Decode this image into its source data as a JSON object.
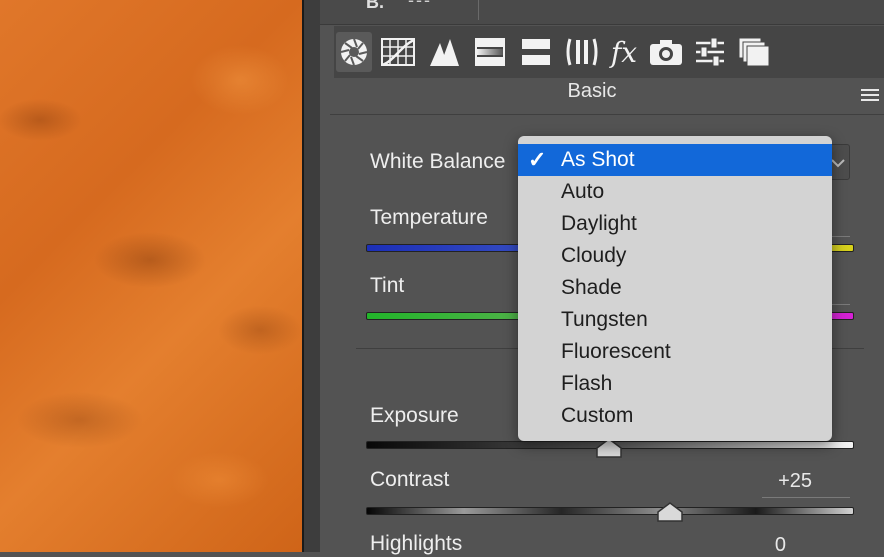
{
  "top_strip": {
    "label": "B.",
    "dashes": "---"
  },
  "toolbar": {
    "tools": [
      {
        "name": "basic-aperture-icon",
        "active": true
      },
      {
        "name": "tone-curve-grid-icon",
        "active": false
      },
      {
        "name": "detail-triangles-icon",
        "active": false
      },
      {
        "name": "hsl-gradient-icon",
        "active": false
      },
      {
        "name": "split-toning-icon",
        "active": false
      },
      {
        "name": "lens-corrections-icon",
        "active": false
      },
      {
        "name": "fx-effects-icon",
        "active": false
      },
      {
        "name": "camera-calibration-icon",
        "active": false
      },
      {
        "name": "presets-sliders-icon",
        "active": false
      },
      {
        "name": "snapshots-stack-icon",
        "active": false
      }
    ],
    "fx_text": "fx"
  },
  "section": {
    "title": "Basic"
  },
  "white_balance": {
    "label": "White Balance"
  },
  "sliders": {
    "temperature": {
      "label": "Temperature"
    },
    "tint": {
      "label": "Tint"
    },
    "exposure": {
      "label": "Exposure",
      "position": 0.5
    },
    "contrast": {
      "label": "Contrast",
      "value": "+25",
      "position": 0.625
    },
    "highlights": {
      "label": "Highlights",
      "value": "0"
    }
  },
  "dropdown": {
    "check_mark": "✓",
    "options": [
      {
        "label": "As Shot",
        "selected": true
      },
      {
        "label": "Auto",
        "selected": false
      },
      {
        "label": "Daylight",
        "selected": false
      },
      {
        "label": "Cloudy",
        "selected": false
      },
      {
        "label": "Shade",
        "selected": false
      },
      {
        "label": "Tungsten",
        "selected": false
      },
      {
        "label": "Fluorescent",
        "selected": false
      },
      {
        "label": "Flash",
        "selected": false
      },
      {
        "label": "Custom",
        "selected": false
      }
    ]
  },
  "colors": {
    "selection": "#1268d9",
    "temp_start": "#1c2fb8",
    "temp_end": "#d8d21a",
    "tint_start": "#22b52a",
    "tint_end": "#d61fd6"
  }
}
